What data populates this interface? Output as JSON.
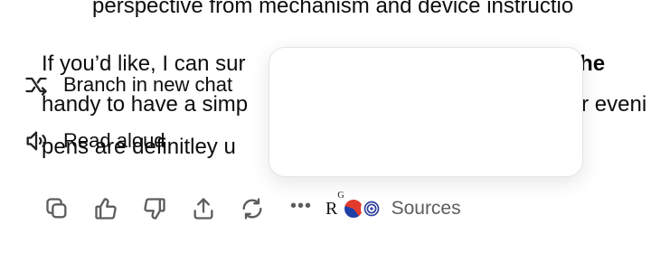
{
  "message": {
    "line0": "perspective from mechanism and device instructio",
    "line1_pre": "If you’d like, I can sur",
    "line1_bold": "the he",
    "line2_pre": "handy to have a simp",
    "line2_post": "r eveni",
    "line3_pre": "pens are definitley u"
  },
  "actions": {
    "copy_icon": "copy-icon",
    "like_icon": "thumbs-up-icon",
    "dislike_icon": "thumbs-down-icon",
    "share_icon": "share-icon",
    "regenerate_icon": "regenerate-icon",
    "more_label": "•••"
  },
  "sources": {
    "logo_text": "R",
    "logo_sup": "G",
    "label": "Sources"
  },
  "menu": {
    "items": [
      {
        "label": "Branch in new chat",
        "icon": "branch-icon"
      },
      {
        "label": "Read aloud",
        "icon": "speaker-icon"
      }
    ]
  },
  "colors": {
    "text": "#0d0d0d",
    "muted": "#5d5d5d",
    "menu_border": "#e4e4e4"
  }
}
